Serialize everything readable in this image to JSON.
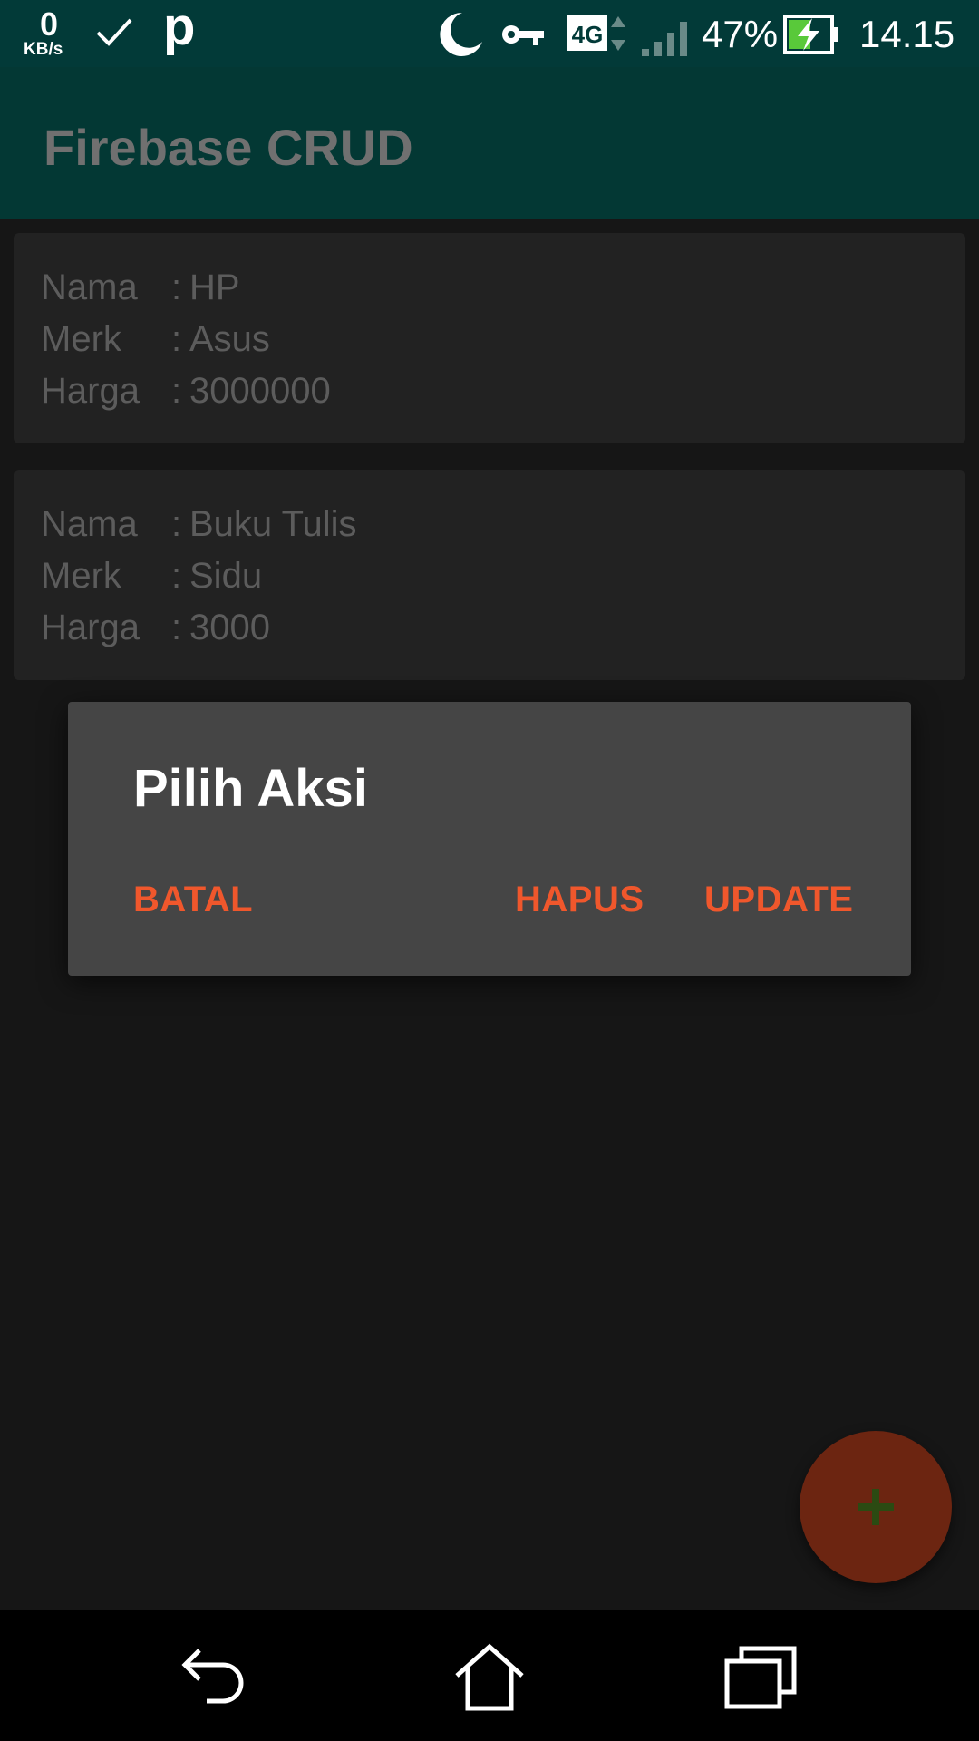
{
  "status_bar": {
    "speed_value": "0",
    "speed_unit": "KB/s",
    "battery_percent": "47%",
    "time": "14.15",
    "network_type": "4G",
    "icons": [
      "check-icon",
      "p-icon",
      "moon-icon",
      "key-icon",
      "lte-icon",
      "signal-icon",
      "battery-charging-icon"
    ],
    "p_label": "p"
  },
  "app_bar": {
    "title": "Firebase CRUD",
    "color": "#033834"
  },
  "items": [
    {
      "fields": [
        {
          "key": "Nama",
          "sep": ":",
          "value": "HP"
        },
        {
          "key": "Merk",
          "sep": ":",
          "value": "Asus"
        },
        {
          "key": "Harga",
          "sep": ":",
          "value": "3000000"
        }
      ]
    },
    {
      "fields": [
        {
          "key": "Nama",
          "sep": ":",
          "value": "Buku Tulis"
        },
        {
          "key": "Merk",
          "sep": ":",
          "value": "Sidu"
        },
        {
          "key": "Harga",
          "sep": ":",
          "value": "3000"
        }
      ]
    }
  ],
  "dialog": {
    "title": "Pilih Aksi",
    "buttons": {
      "batal": "BATAL",
      "hapus": "HAPUS",
      "update": "UPDATE"
    },
    "accent_color": "#f0572c"
  },
  "fab": {
    "icon": "plus-icon",
    "color": "#6c2511"
  },
  "nav_bar": {
    "icons": [
      "back-icon",
      "home-icon",
      "recent-apps-icon"
    ]
  }
}
